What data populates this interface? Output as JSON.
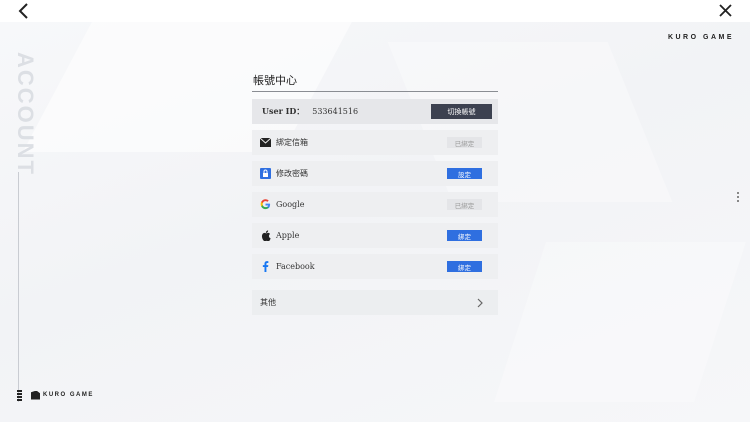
{
  "top": {
    "back_icon": "chevron-left-icon",
    "close_icon": "close-icon"
  },
  "brand": {
    "top": "KURO GAME",
    "bottom": "KURO GAME",
    "vertical_word": "ACCOUNT"
  },
  "panel": {
    "title": "帳號中心",
    "user_id_label": "User ID：",
    "user_id_value": "533641516",
    "switch_label": "切換帳號",
    "rows": [
      {
        "icon": "mail-icon",
        "label": "綁定信箱",
        "action": "已綁定",
        "state": "done"
      },
      {
        "icon": "lock-icon",
        "label": "修改密碼",
        "action": "設定",
        "state": "active"
      },
      {
        "icon": "google-icon",
        "label": "Google",
        "action": "已綁定",
        "state": "done"
      },
      {
        "icon": "apple-icon",
        "label": "Apple",
        "action": "綁定",
        "state": "active"
      },
      {
        "icon": "facebook-icon",
        "label": "Facebook",
        "action": "綁定",
        "state": "active"
      }
    ],
    "more_label": "其他"
  },
  "colors": {
    "accent": "#2f6fe0",
    "dark_button": "#3c4150",
    "row_bg": "#eeeff1"
  }
}
